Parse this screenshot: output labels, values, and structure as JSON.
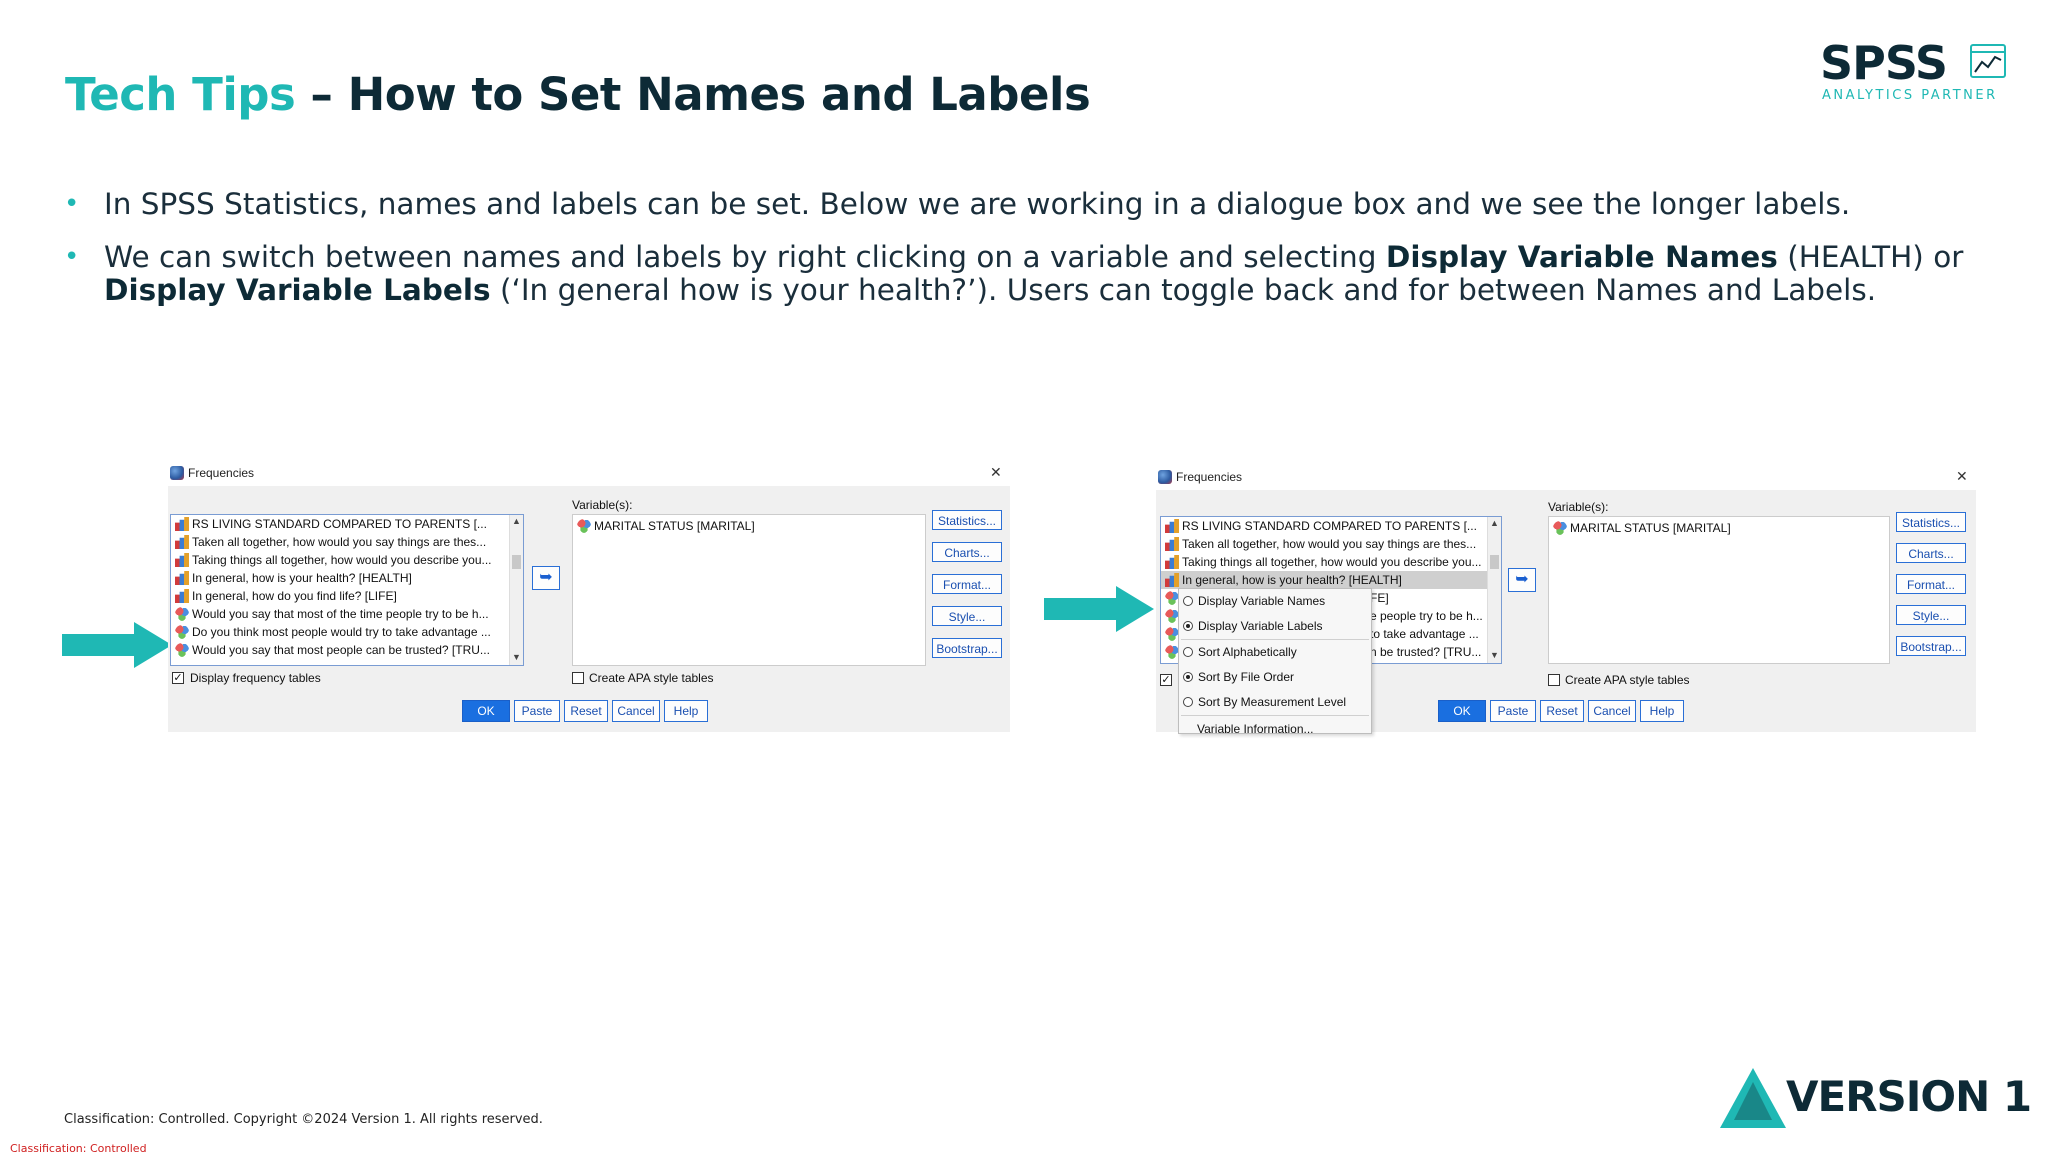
{
  "slide": {
    "title_accent": "Tech Tips",
    "title_rest": " – How to Set Names and Labels",
    "bullets": [
      {
        "parts": [
          "In SPSS Statistics, names and labels can be set. Below we are working in a dialogue box and we see the longer labels."
        ]
      },
      {
        "t1": "We can switch between names and labels by right clicking on a variable and selecting ",
        "b1": "Display Variable Names",
        "t2": " (HEALTH) or ",
        "b2": "Display Variable Labels",
        "t3": " (‘In general how is your health?’). Users can toggle back and for between Names and Labels."
      }
    ]
  },
  "logo": {
    "word": "SPSS",
    "tagline": "ANALYTICS PARTNER"
  },
  "dialog_left": {
    "title": "Frequencies",
    "close": "✕",
    "source_vars": [
      {
        "label": "RS LIVING STANDARD COMPARED TO PARENTS [...",
        "icon": "scale"
      },
      {
        "label": "Taken all together, how would you say things are thes...",
        "icon": "scale"
      },
      {
        "label": "Taking things all together, how would you describe you...",
        "icon": "scale"
      },
      {
        "label": "In general, how is your health? [HEALTH]",
        "icon": "scale"
      },
      {
        "label": "In general, how do you find life?  [LIFE]",
        "icon": "scale"
      },
      {
        "label": "Would you say that most of the time people try to be h...",
        "icon": "nominal"
      },
      {
        "label": "Do you think most people would try to take advantage ...",
        "icon": "nominal"
      },
      {
        "label": "Would you say that most people can be trusted? [TRU...",
        "icon": "nominal"
      }
    ],
    "target_header": "Variable(s):",
    "target_vars": [
      "MARITAL STATUS [MARITAL]"
    ],
    "side_buttons": [
      "Statistics...",
      "Charts...",
      "Format...",
      "Style...",
      "Bootstrap..."
    ],
    "display_freq_label": "Display frequency tables",
    "display_freq_checked": true,
    "apa_label": "Create APA style tables",
    "apa_checked": false,
    "buttons": [
      "OK",
      "Paste",
      "Reset",
      "Cancel",
      "Help"
    ]
  },
  "dialog_right": {
    "title": "Frequencies",
    "close": "✕",
    "source_vars": [
      {
        "label": "RS LIVING STANDARD COMPARED TO PARENTS [...",
        "icon": "scale"
      },
      {
        "label": "Taken all together, how would you say things are thes...",
        "icon": "scale"
      },
      {
        "label": "Taking things all together, how would you describe you...",
        "icon": "scale"
      },
      {
        "label": "In general, how is your health? [HEALTH]",
        "icon": "scale"
      },
      {
        "label": "FE]",
        "icon": "nominal"
      },
      {
        "label": "e people try to be h...",
        "icon": "nominal"
      },
      {
        "label": "to take advantage ...",
        "icon": "nominal"
      },
      {
        "label": "n be trusted? [TRU...",
        "icon": "nominal"
      }
    ],
    "target_header": "Variable(s):",
    "target_vars": [
      "MARITAL STATUS [MARITAL]"
    ],
    "side_buttons": [
      "Statistics...",
      "Charts...",
      "Format...",
      "Style...",
      "Bootstrap..."
    ],
    "apa_label": "Create APA style tables",
    "apa_checked": false,
    "buttons": [
      "OK",
      "Paste",
      "Reset",
      "Cancel",
      "Help"
    ],
    "context_menu": [
      {
        "label": "Display Variable Names",
        "selected": false
      },
      {
        "label": "Display Variable Labels",
        "selected": true
      },
      {
        "label": "Sort Alphabetically",
        "selected": false
      },
      {
        "label": "Sort By File Order",
        "selected": true
      },
      {
        "label": "Sort By Measurement Level",
        "selected": false
      },
      {
        "label": "Variable Information...",
        "selected": false
      }
    ]
  },
  "footer": {
    "copyright": "Classification: Controlled. Copyright ©2024 Version 1. All rights reserved.",
    "classification": "Classification: Controlled",
    "brand": "VERSION 1"
  },
  "colors": {
    "accent": "#1fb8b4",
    "navy": "#0d2a36",
    "ok_button": "#1a6fe0",
    "classification_red": "#d02020"
  }
}
